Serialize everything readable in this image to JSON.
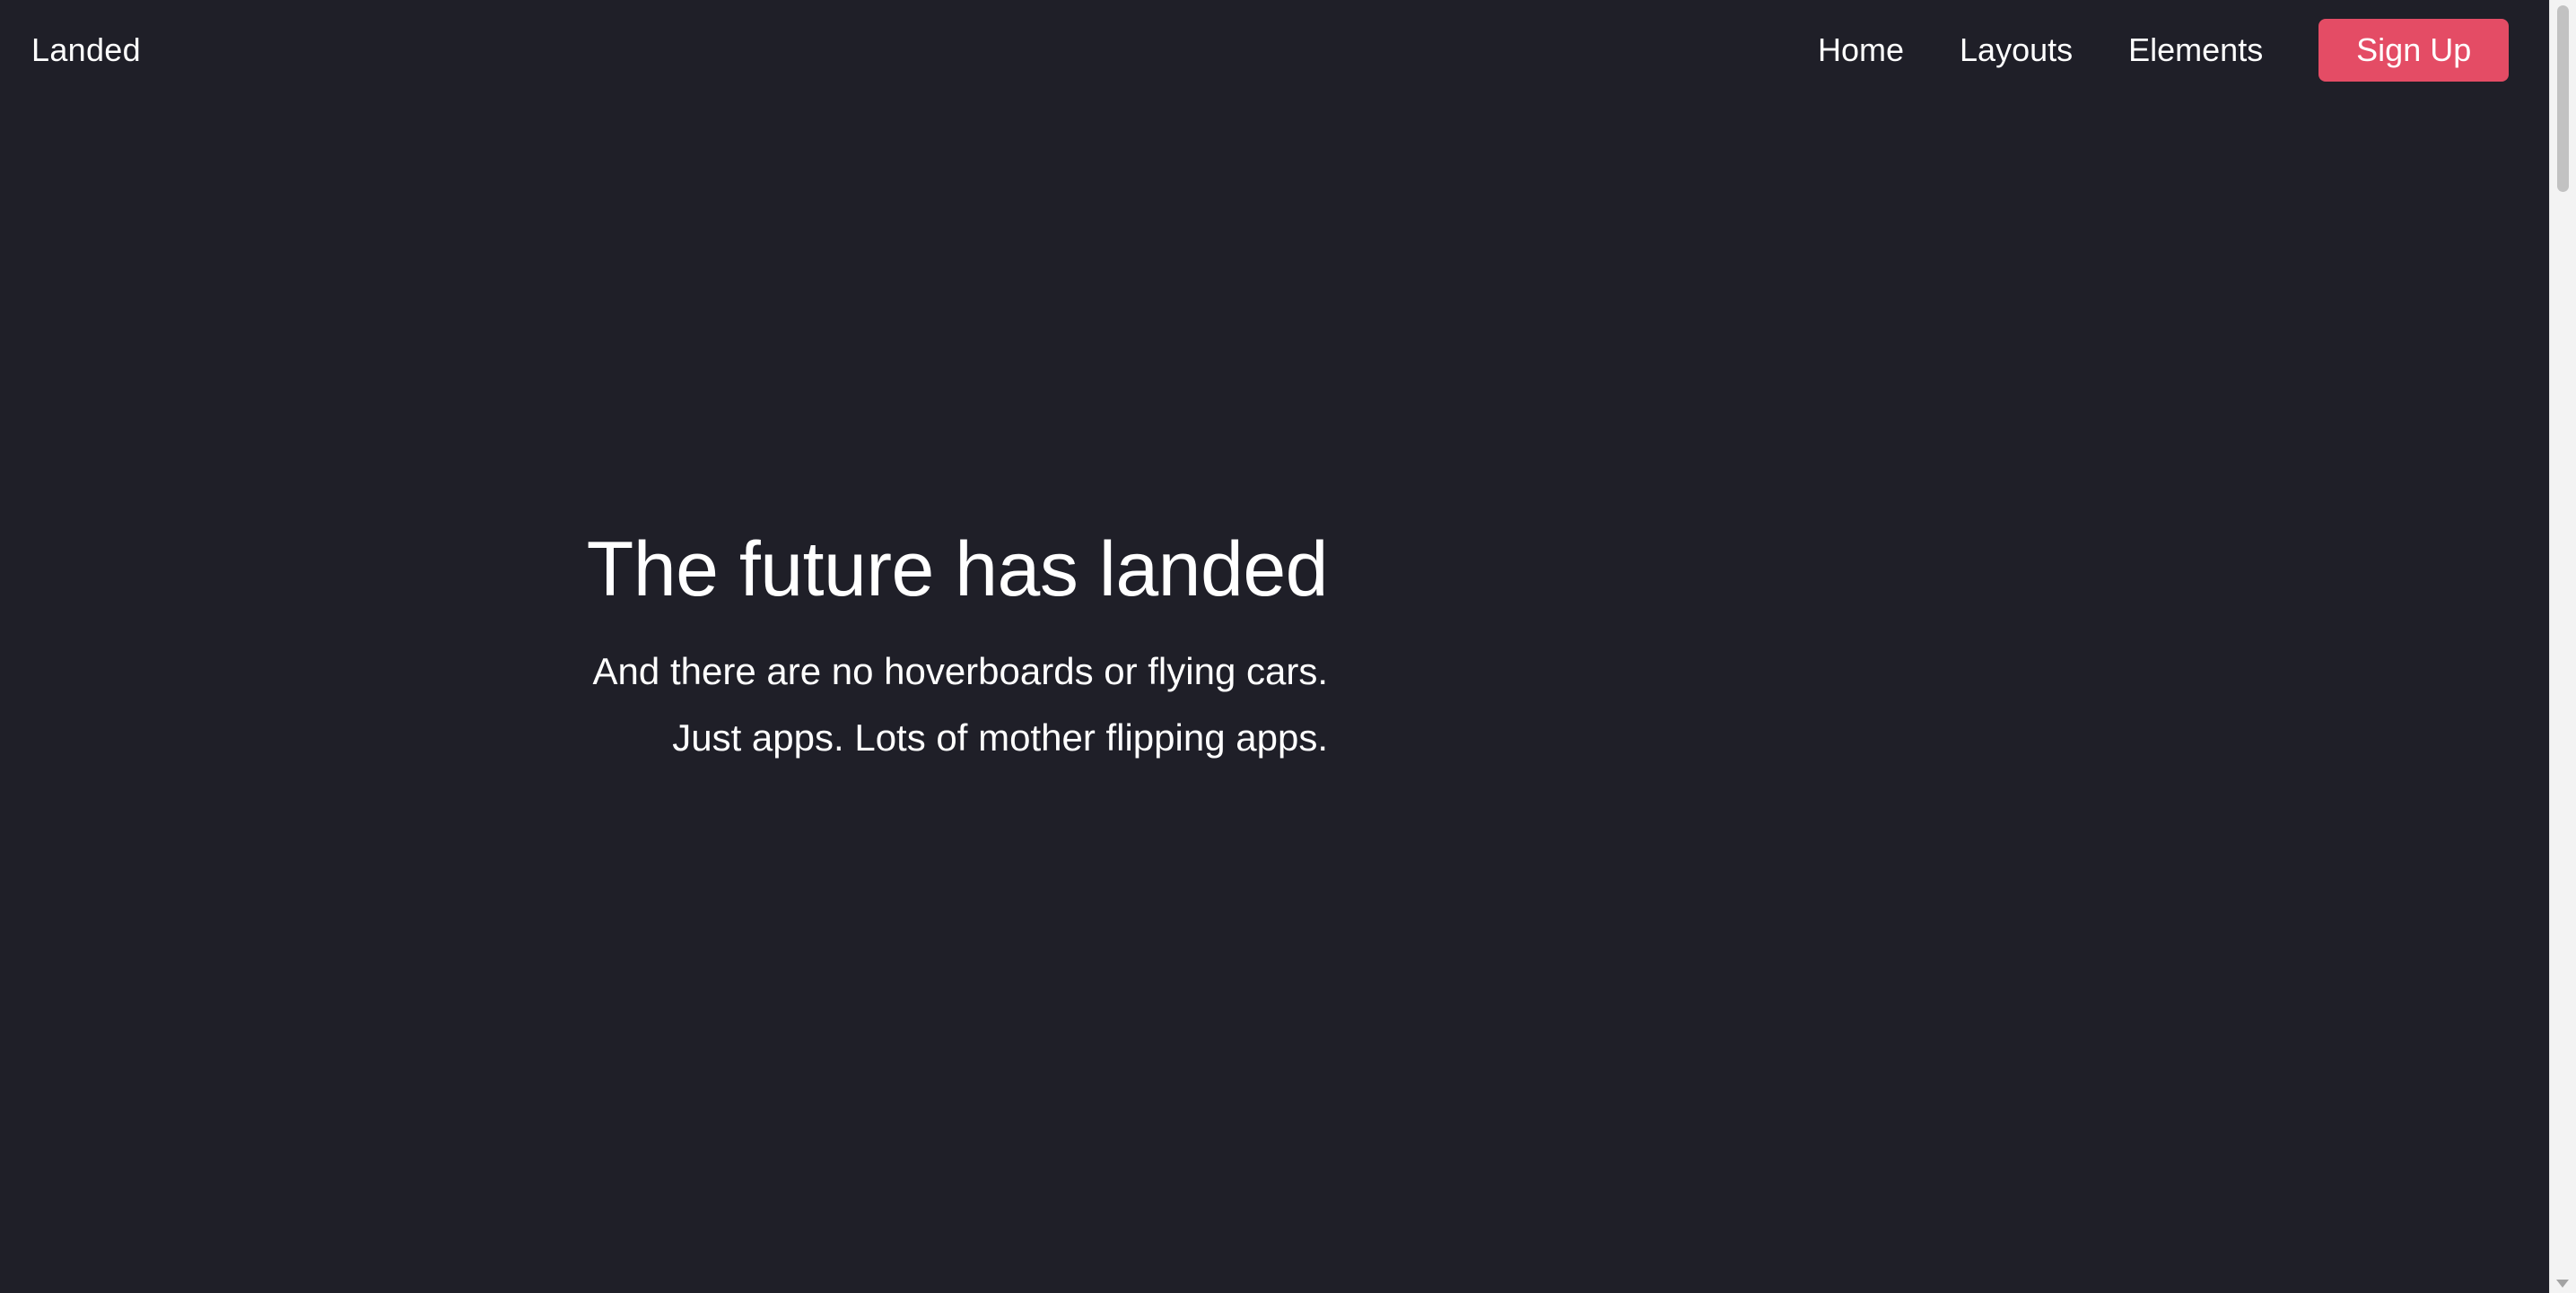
{
  "header": {
    "brand": "Landed",
    "nav": [
      "Home",
      "Layouts",
      "Elements"
    ],
    "signup_label": "Sign Up"
  },
  "hero": {
    "title": "The future has landed",
    "subtitle_lines": [
      "And there are no hoverboards or flying cars.",
      "Just apps. Lots of mother flipping apps."
    ]
  },
  "colors": {
    "background": "#1f1f28",
    "accent": "#e44c65",
    "text": "#ffffff"
  }
}
